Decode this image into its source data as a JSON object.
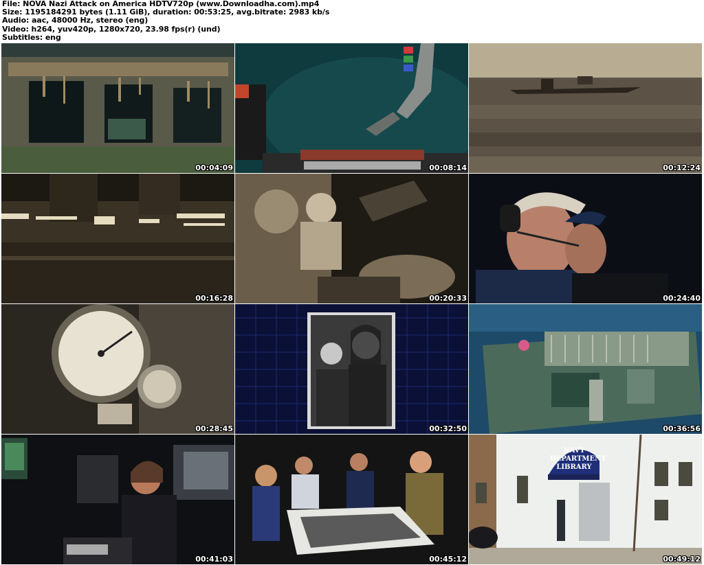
{
  "info": {
    "file": "File: NOVA Nazi Attack on America HDTV720p (www.Downloadha.com).mp4",
    "size": "Size: 1195184291 bytes (1.11 GiB), duration: 00:53:25, avg.bitrate: 2983 kb/s",
    "audio": "Audio: aac, 48000 Hz, stereo (eng)",
    "video": "Video: h264, yuv420p, 1280x720, 23.98 fps(r) (und)",
    "subtitles": "Subtitles: eng"
  },
  "thumbnails": [
    {
      "time": "00:04:09"
    },
    {
      "time": "00:08:14"
    },
    {
      "time": "00:12:24"
    },
    {
      "time": "00:16:28"
    },
    {
      "time": "00:20:33"
    },
    {
      "time": "00:24:40"
    },
    {
      "time": "00:28:45"
    },
    {
      "time": "00:32:50"
    },
    {
      "time": "00:36:56"
    },
    {
      "time": "00:41:03"
    },
    {
      "time": "00:45:12",
      "sign": ""
    },
    {
      "time": "00:49:12",
      "sign": "NAVY DEPARTMENT LIBRARY"
    }
  ]
}
